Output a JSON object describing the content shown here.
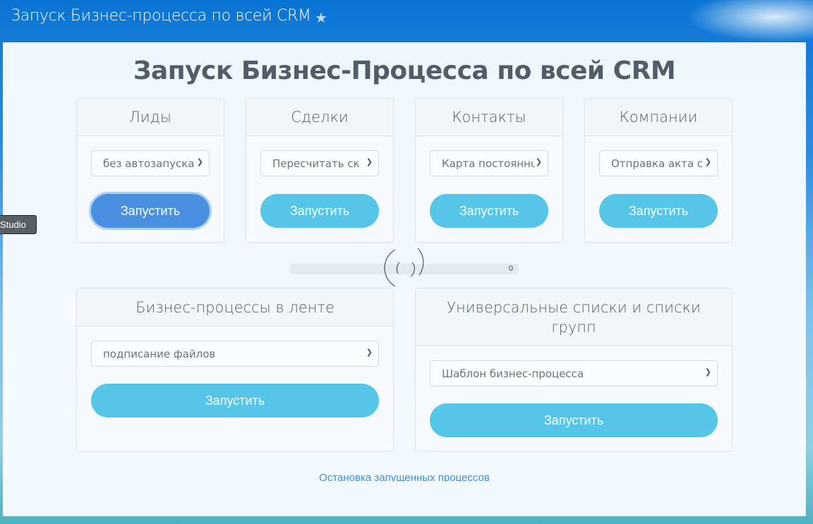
{
  "window": {
    "title": "Запуск Бизнес-процесса по всей CRM",
    "favorite_icon": "star-icon"
  },
  "main": {
    "heading": "Запуск Бизнес-Процесса по всей CRM",
    "entity_cards": [
      {
        "title": "Лиды",
        "selected": "без автозапуска",
        "button": "Запустить"
      },
      {
        "title": "Сделки",
        "selected": "Пересчитать ск",
        "button": "Запустить"
      },
      {
        "title": "Контакты",
        "selected": "Карта постоянно",
        "button": "Запустить"
      },
      {
        "title": "Компании",
        "selected": "Отправка акта с",
        "button": "Запустить"
      }
    ],
    "progress": {
      "value": 0,
      "label": "0"
    },
    "feed_card": {
      "title": "Бизнес-процессы в ленте",
      "selected": "подписание файлов",
      "button": "Запустить"
    },
    "lists_card": {
      "title": "Универсальные списки и списки групп",
      "selected": "Шаблон бизнес-процесса",
      "button": "Запустить"
    },
    "stop_link": "Остановка запущенных процессов"
  },
  "tooltip": "Studio",
  "colors": {
    "button": "#55c5e8",
    "button_active": "#4a90e0",
    "link": "#3a8fd8"
  }
}
